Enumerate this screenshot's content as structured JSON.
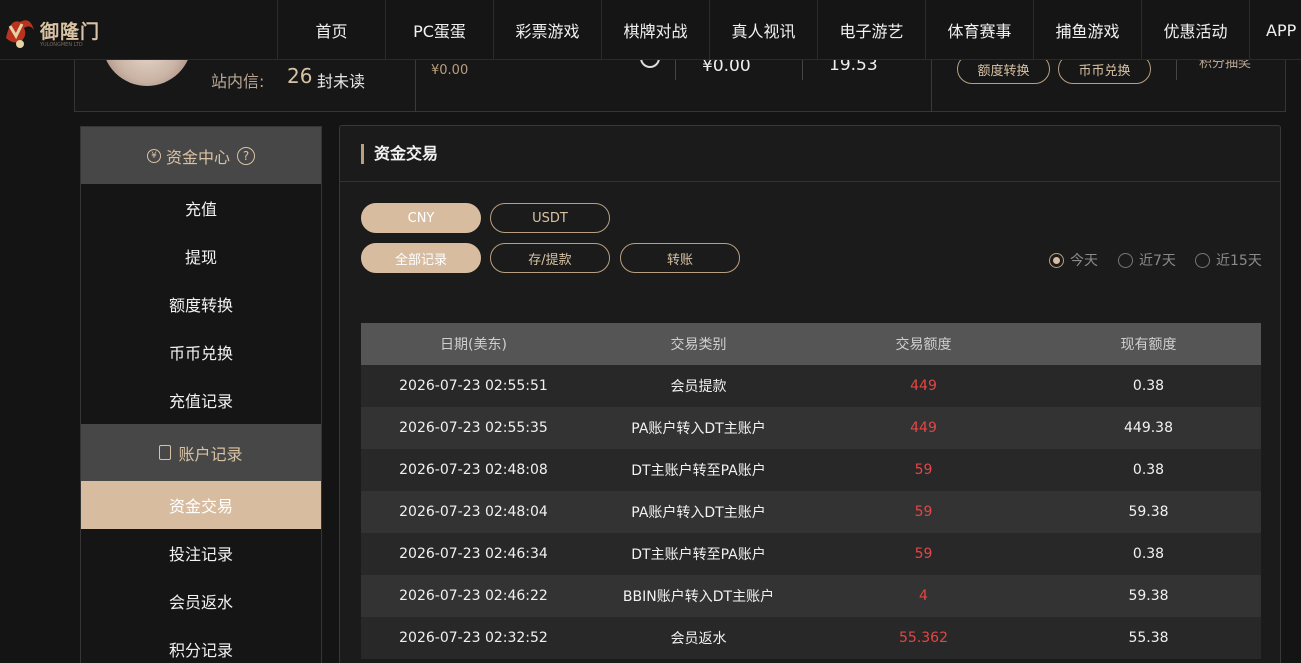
{
  "header": {
    "logo_text": "御隆门",
    "logo_tagline": "YULONGMEN LTD",
    "nav": [
      "首页",
      "PC蛋蛋",
      "彩票游戏",
      "棋牌对战",
      "真人视讯",
      "电子游艺",
      "体育赛事",
      "捕鱼游戏",
      "优惠活动",
      "APP"
    ]
  },
  "profile": {
    "msg_label": "站内信:",
    "msg_count": "26",
    "msg_unit": "封未读",
    "balance_small": "¥0.00",
    "balance_main": "¥0.00",
    "balance_points": "19.53",
    "btn_transfer": "额度转换",
    "btn_exchange": "币币兑换",
    "reward_label": "积分抽奖"
  },
  "sidebar": {
    "section1_title": "资金中心",
    "section1_items": [
      "充值",
      "提现",
      "额度转换",
      "币币兑换",
      "充值记录"
    ],
    "section2_title": "账户记录",
    "section2_items": [
      "资金交易",
      "投注记录",
      "会员返水",
      "积分记录"
    ],
    "active_item": "资金交易"
  },
  "main": {
    "title": "资金交易",
    "currency_tabs": [
      "CNY",
      "USDT"
    ],
    "currency_active": "CNY",
    "type_tabs": [
      "全部记录",
      "存/提款",
      "转账"
    ],
    "type_active": "全部记录",
    "range_options": [
      "今天",
      "近7天",
      "近15天"
    ],
    "range_active": "今天",
    "columns": [
      "日期(美东)",
      "交易类别",
      "交易额度",
      "现有额度"
    ],
    "rows": [
      [
        "2026-07-23 02:55:51",
        "会员提款",
        "449",
        "0.38"
      ],
      [
        "2026-07-23 02:55:35",
        "PA账户转入DT主账户",
        "449",
        "449.38"
      ],
      [
        "2026-07-23 02:48:08",
        "DT主账户转至PA账户",
        "59",
        "0.38"
      ],
      [
        "2026-07-23 02:48:04",
        "PA账户转入DT主账户",
        "59",
        "59.38"
      ],
      [
        "2026-07-23 02:46:34",
        "DT主账户转至PA账户",
        "59",
        "0.38"
      ],
      [
        "2026-07-23 02:46:22",
        "BBIN账户转入DT主账户",
        "4",
        "59.38"
      ],
      [
        "2026-07-23 02:32:52",
        "会员返水",
        "55.362",
        "55.38"
      ]
    ]
  },
  "colors": {
    "accent": "#d8bca0",
    "amount_red": "#e64545",
    "background": "#141414"
  }
}
